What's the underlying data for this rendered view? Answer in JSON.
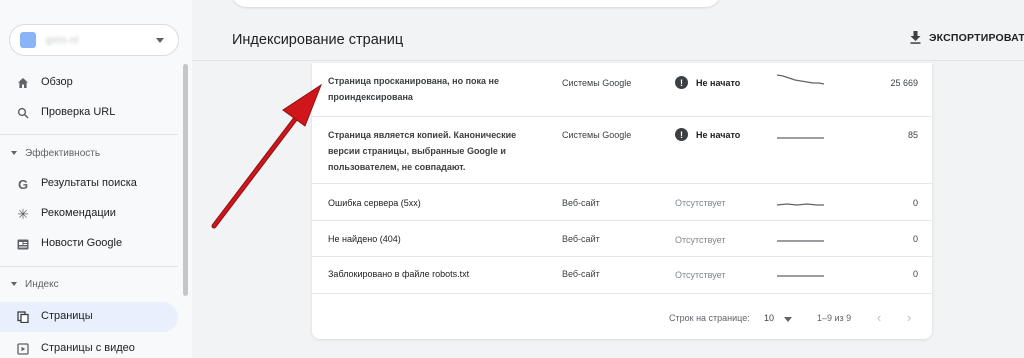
{
  "sidebar": {
    "property": {
      "name": "gsto.nl",
      "icon": "property-favicon"
    },
    "overview": {
      "label": "Обзор",
      "icon": "home-icon"
    },
    "url_inspection": {
      "label": "Проверка URL",
      "icon": "search-icon"
    },
    "section_performance": "Эффективность",
    "search_results": {
      "label": "Результаты поиска",
      "icon": "google-g-icon"
    },
    "discover": {
      "label": "Рекомендации",
      "icon": "asterisk-icon"
    },
    "google_news": {
      "label": "Новости Google",
      "icon": "news-icon"
    },
    "section_index": "Индекс",
    "pages": {
      "label": "Страницы",
      "icon": "pages-icon"
    },
    "video_pages": {
      "label": "Страницы с видео",
      "icon": "video-icon"
    }
  },
  "header": {
    "title": "Индексирование страниц",
    "export_label": "ЭКСПОРТИРОВАТЬ"
  },
  "table": {
    "rows": [
      {
        "reason": "Страница просканирована, но пока не проиндексирована",
        "source": "Системы Google",
        "status": "Не начато",
        "status_icon": "exclamation-icon",
        "count": "25 669",
        "trend": "declining"
      },
      {
        "reason": "Страница является копией. Канонические версии страницы, выбранные Google и пользователем, не совпадают.",
        "source": "Системы Google",
        "status": "Не начато",
        "status_icon": "exclamation-icon",
        "count": "85",
        "trend": "flat"
      },
      {
        "reason": "Ошибка сервера (5xx)",
        "source": "Веб-сайт",
        "status": "Отсутствует",
        "count": "0",
        "trend": "flat"
      },
      {
        "reason": "Не найдено (404)",
        "source": "Веб-сайт",
        "status": "Отсутствует",
        "count": "0",
        "trend": "flat"
      },
      {
        "reason": "Заблокировано в файле robots.txt",
        "source": "Веб-сайт",
        "status": "Отсутствует",
        "count": "0",
        "trend": "flat"
      }
    ]
  },
  "pagination": {
    "rows_per_page_label": "Строк на странице:",
    "rows_per_page": "10",
    "range": "1–9 из 9"
  },
  "colors": {
    "arrow": "#d0161b",
    "active_nav": "#e8f0fe"
  }
}
